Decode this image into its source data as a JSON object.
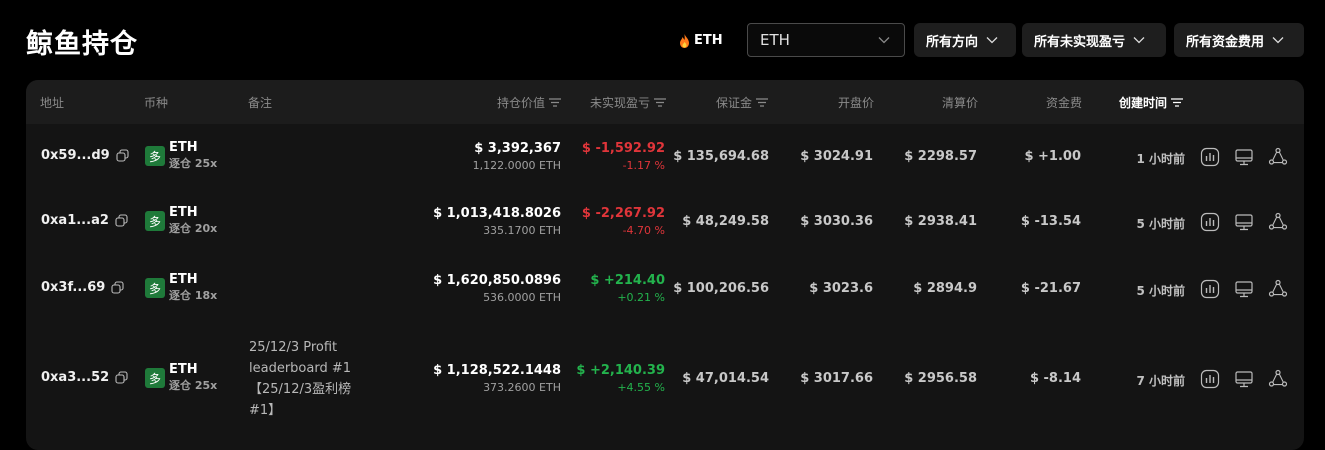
{
  "page": {
    "title": "鲸鱼持仓"
  },
  "toolbar": {
    "coin_tag": "ETH",
    "coin_select_value": "ETH",
    "filters": {
      "direction": "所有方向",
      "pnl": "所有未实现盈亏",
      "funding": "所有资金费用"
    }
  },
  "table": {
    "headers": {
      "address": "地址",
      "coin": "币种",
      "note": "备注",
      "position_value": "持仓价值",
      "unrealized_pnl": "未实现盈亏",
      "margin": "保证金",
      "entry_price": "开盘价",
      "liq_price": "清算价",
      "funding": "资金费",
      "created": "创建时间"
    },
    "rows": [
      {
        "address": "0x59...d9",
        "direction": "多",
        "coin": "ETH",
        "leverage": "逐仓 25x",
        "note": "",
        "value": "$ 3,392,367",
        "value_sub": "1,122.0000 ETH",
        "pnl": "$ -1,592.92",
        "pnl_pct": "-1.17 %",
        "margin": "$ 135,694.68",
        "entry": "$ 3024.91",
        "liq": "$ 2298.57",
        "funding": "$ +1.00",
        "time": "1 小时前"
      },
      {
        "address": "0xa1...a2",
        "direction": "多",
        "coin": "ETH",
        "leverage": "逐仓 20x",
        "note": "",
        "value": "$ 1,013,418.8026",
        "value_sub": "335.1700 ETH",
        "pnl": "$ -2,267.92",
        "pnl_pct": "-4.70 %",
        "margin": "$ 48,249.58",
        "entry": "$ 3030.36",
        "liq": "$ 2938.41",
        "funding": "$ -13.54",
        "time": "5 小时前"
      },
      {
        "address": "0x3f...69",
        "direction": "多",
        "coin": "ETH",
        "leverage": "逐仓 18x",
        "note": "",
        "value": "$ 1,620,850.0896",
        "value_sub": "536.0000 ETH",
        "pnl": "$ +214.40",
        "pnl_pct": "+0.21 %",
        "margin": "$ 100,206.56",
        "entry": "$ 3023.6",
        "liq": "$ 2894.9",
        "funding": "$ -21.67",
        "time": "5 小时前"
      },
      {
        "address": "0xa3...52",
        "direction": "多",
        "coin": "ETH",
        "leverage": "逐仓 25x",
        "note": "25/12/3 Profit leaderboard #1 【25/12/3盈利榜#1】",
        "value": "$ 1,128,522.1448",
        "value_sub": "373.2600 ETH",
        "pnl": "$ +2,140.39",
        "pnl_pct": "+4.55 %",
        "margin": "$ 47,014.54",
        "entry": "$ 3017.66",
        "liq": "$ 2956.58",
        "funding": "$ -8.14",
        "time": "7 小时前"
      }
    ]
  },
  "colors": {
    "negative": "#e0353a",
    "positive": "#23b34d",
    "long_badge": "#1f7a3a"
  },
  "icons": [
    "flame-icon",
    "chevron-down-icon",
    "sort-icon",
    "copy-icon",
    "chart-icon",
    "monitor-icon",
    "share-icon"
  ]
}
